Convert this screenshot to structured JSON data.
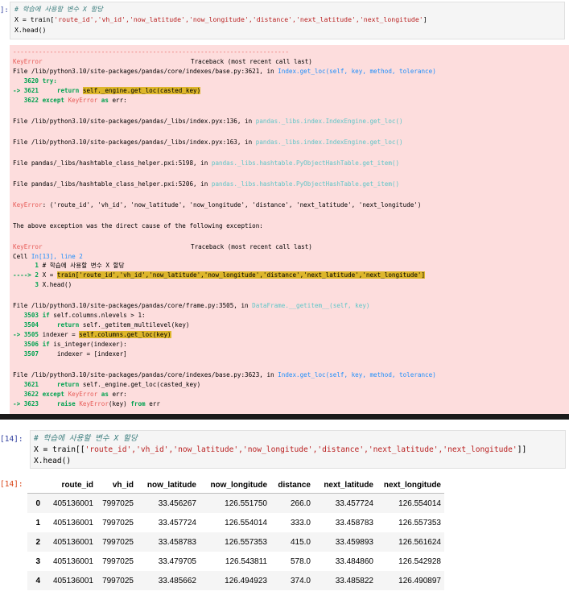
{
  "cell13": {
    "prompt": "]:",
    "code": {
      "line1_comment": "# 학습에 사용할 변수 X 할당",
      "line2_head": "X = train[",
      "line2_strings": "'route_id','vh_id','now_latitude','now_longitude','distance','next_latitude','next_longitude'",
      "line2_tail": "]",
      "line3": "X.head()"
    },
    "traceback": {
      "dashes": "---------------------------------------------------------------------------",
      "error1": "KeyError",
      "tb_header": "Traceback (most recent call last)",
      "f1_path": "File /lib/python3.10/site-packages/pandas/core/indexes/base.py:3621, in ",
      "f1_func": "Index.get_loc(self, key, method, tolerance)",
      "l3620_no": "   3620 ",
      "l3620_kw": "try:",
      "l3621_arrow": "-> 3621     ",
      "l3621_kw": "return ",
      "l3621_hl": "self._engine.get_loc(casted_key)",
      "l3622_no": "   3622 ",
      "l3622_kw": "except ",
      "l3622_err": "KeyError ",
      "l3622_kw2": "as ",
      "l3622_tail": "err:",
      "f2_path": "File /lib/python3.10/site-packages/pandas/_libs/index.pyx:136, in ",
      "f2_func": "pandas._libs.index.IndexEngine.get_loc()",
      "f3_path": "File /lib/python3.10/site-packages/pandas/_libs/index.pyx:163, in ",
      "f3_func": "pandas._libs.index.IndexEngine.get_loc()",
      "f4_path": "File pandas/_libs/hashtable_class_helper.pxi:5198, in ",
      "f4_func": "pandas._libs.hashtable.PyObjectHashTable.get_item()",
      "f5_path": "File pandas/_libs/hashtable_class_helper.pxi:5206, in ",
      "f5_func": "pandas._libs.hashtable.PyObjectHashTable.get_item()",
      "keyerror_label": "KeyError",
      "keyerror_msg": ": ('route_id', 'vh_id', 'now_latitude', 'now_longitude', 'distance', 'next_latitude', 'next_longitude')",
      "cause": "The above exception was the direct cause of the following exception:",
      "error2": "KeyError",
      "tb_header2": "Traceback (most recent call last)",
      "cell_ref_a": "Cell ",
      "cell_ref_b": "In[13], line 2",
      "c1_no": "      1 ",
      "c1_cmt": "# 학습에 사용할 변수 X 할당",
      "c2_arrow": "----> 2 ",
      "c2_a": "X = ",
      "c2_hl": "train['route_id','vh_id','now_latitude','now_longitude','distance','next_latitude','next_longitude']",
      "c3_no": "      3 ",
      "c3_code": "X.head()",
      "f6_path": "File /lib/python3.10/site-packages/pandas/core/frame.py:3505, in ",
      "f6_func": "DataFrame.__getitem__(self, key)",
      "l3503_no": "   3503 ",
      "l3503_kw": "if ",
      "l3503_tail": "self.columns.nlevels > 1:",
      "l3504_no": "   3504     ",
      "l3504_kw": "return ",
      "l3504_tail": "self._getitem_multilevel(key)",
      "l3505_arrow": "-> 3505 ",
      "l3505_a": "indexer = ",
      "l3505_hl": "self.columns.get_loc(key)",
      "l3506_no": "   3506 ",
      "l3506_kw": "if ",
      "l3506_tail": "is_integer(indexer):",
      "l3507_no": "   3507     ",
      "l3507_tail": "indexer = [indexer]",
      "f7_path": "File /lib/python3.10/site-packages/pandas/core/indexes/base.py:3623, in ",
      "f7_func": "Index.get_loc(self, key, method, tolerance)",
      "m3621_no": "   3621     ",
      "m3621_kw": "return ",
      "m3621_tail": "self._engine.get_loc(casted_key)",
      "m3622_no": "   3622 ",
      "m3622_kw": "except ",
      "m3622_err": "KeyError ",
      "m3622_kw2": "as ",
      "m3622_tail": "err:",
      "m3623_arrow": "-> 3623     ",
      "m3623_kw": "raise ",
      "m3623_err": "KeyError",
      "m3623_mid": "(key) ",
      "m3623_kw2": "from ",
      "m3623_tail": "err"
    }
  },
  "cell14": {
    "input_prompt": "[14]:",
    "output_prompt": "[14]:",
    "code": {
      "line1_comment": "# 학습에 사용할 변수 X 할당",
      "line2_head": "X = train[[",
      "line2_strings": "'route_id','vh_id','now_latitude','now_longitude','distance','next_latitude','next_longitude'",
      "line2_tail": "]]",
      "line3": "X.head()"
    },
    "table": {
      "columns": [
        "",
        "route_id",
        "vh_id",
        "now_latitude",
        "now_longitude",
        "distance",
        "next_latitude",
        "next_longitude"
      ],
      "rows": [
        [
          "0",
          "405136001",
          "7997025",
          "33.456267",
          "126.551750",
          "266.0",
          "33.457724",
          "126.554014"
        ],
        [
          "1",
          "405136001",
          "7997025",
          "33.457724",
          "126.554014",
          "333.0",
          "33.458783",
          "126.557353"
        ],
        [
          "2",
          "405136001",
          "7997025",
          "33.458783",
          "126.557353",
          "415.0",
          "33.459893",
          "126.561624"
        ],
        [
          "3",
          "405136001",
          "7997025",
          "33.479705",
          "126.543811",
          "578.0",
          "33.484860",
          "126.542928"
        ],
        [
          "4",
          "405136001",
          "7997025",
          "33.485662",
          "126.494923",
          "374.0",
          "33.485822",
          "126.490897"
        ]
      ]
    }
  }
}
